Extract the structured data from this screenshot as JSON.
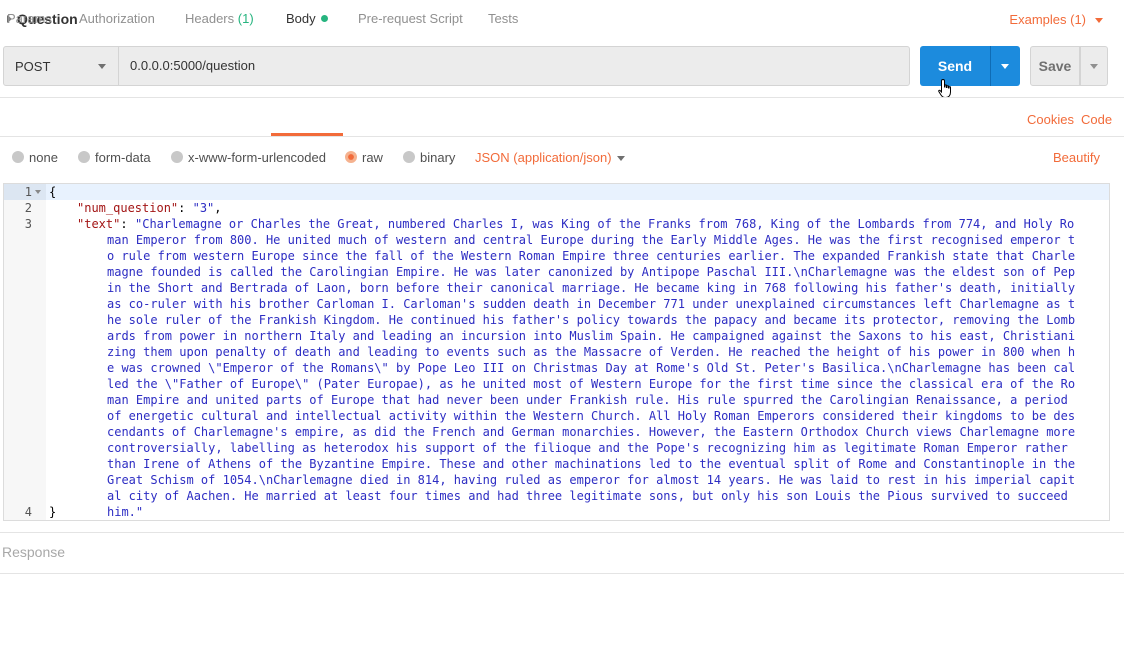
{
  "top": {
    "title": "Question",
    "examples_label": "Examples (1)"
  },
  "request": {
    "method": "POST",
    "url": "0.0.0.0:5000/question",
    "send_label": "Send",
    "save_label": "Save"
  },
  "tabs": [
    {
      "label": "Params"
    },
    {
      "label": "Authorization"
    },
    {
      "label": "Headers",
      "count": "(1)"
    },
    {
      "label": "Body"
    },
    {
      "label": "Pre-request Script"
    },
    {
      "label": "Tests"
    }
  ],
  "links": {
    "cookies": "Cookies",
    "code": "Code",
    "beautify": "Beautify"
  },
  "body_types": [
    {
      "label": "none"
    },
    {
      "label": "form-data"
    },
    {
      "label": "x-www-form-urlencoded"
    },
    {
      "label": "raw"
    },
    {
      "label": "binary"
    }
  ],
  "content_type": "JSON (application/json)",
  "editor": {
    "line_numbers": [
      "1",
      "2",
      "3",
      "4"
    ],
    "open_brace": "{",
    "close_brace": "}",
    "num_question_key": "\"num_question\"",
    "num_question_value": "\"3\"",
    "text_key": "\"text\"",
    "text_value": "\"Charlemagne or Charles the Great, numbered Charles I, was King of the Franks from 768, King of the Lombards from 774, and Holy Roman Emperor from 800. He united much of western and central Europe during the Early Middle Ages. He was the first recognised emperor to rule from western Europe since the fall of the Western Roman Empire three centuries earlier. The expanded Frankish state that Charlemagne founded is called the Carolingian Empire. He was later canonized by Antipope Paschal III.\\nCharlemagne was the eldest son of Pepin the Short and Bertrada of Laon, born before their canonical marriage. He became king in 768 following his father's death, initially as co-ruler with his brother Carloman I. Carloman's sudden death in December 771 under unexplained circumstances left Charlemagne as the sole ruler of the Frankish Kingdom. He continued his father's policy towards the papacy and became its protector, removing the Lombards from power in northern Italy and leading an incursion into Muslim Spain. He campaigned against the Saxons to his east, Christianizing them upon penalty of death and leading to events such as the Massacre of Verden. He reached the height of his power in 800 when he was crowned \\\"Emperor of the Romans\\\" by Pope Leo III on Christmas Day at Rome's Old St. Peter's Basilica.\\nCharlemagne has been called the \\\"Father of Europe\\\" (Pater Europae), as he united most of Western Europe for the first time since the classical era of the Roman Empire and united parts of Europe that had never been under Frankish rule. His rule spurred the Carolingian Renaissance, a period of energetic cultural and intellectual activity within the Western Church. All Holy Roman Emperors considered their kingdoms to be descendants of Charlemagne's empire, as did the French and German monarchies. However, the Eastern Orthodox Church views Charlemagne more controversially, labelling as heterodox his support of the filioque and the Pope's recognizing him as legitimate Roman Emperor rather than Irene of Athens of the Byzantine Empire. These and other machinations led to the eventual split of Rome and Constantinople in the Great Schism of 1054.\\nCharlemagne died in 814, having ruled as emperor for almost 14 years. He was laid to rest in his imperial capital city of Aachen. He married at least four times and had three legitimate sons, but only his son Louis the Pious survived to succeed him.\""
  },
  "response_label": "Response",
  "colors": {
    "accent": "#f26b3a",
    "send": "#1c8bdd",
    "json_key": "#a31515",
    "json_string": "#2d2dc3",
    "badge_green": "#26b47f"
  }
}
